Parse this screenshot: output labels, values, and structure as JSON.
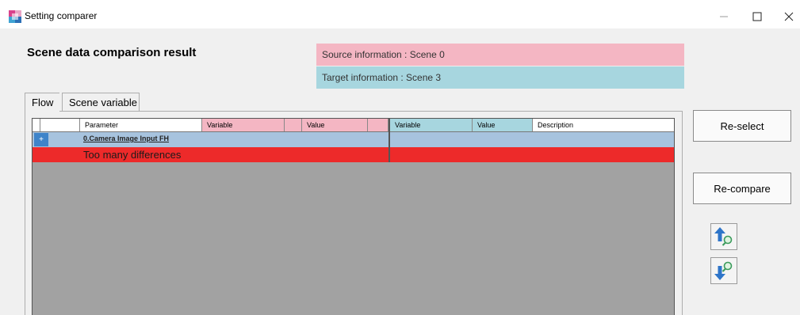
{
  "window": {
    "title": "Setting comparer",
    "icons": {
      "app": "app-icon",
      "minimize": "minimize-icon",
      "maximize": "maximize-icon",
      "close": "close-icon"
    }
  },
  "main": {
    "heading": "Scene data comparison result",
    "source_info": "Source information : Scene 0",
    "target_info": "Target information : Scene 3"
  },
  "tabs": [
    {
      "label": "Flow",
      "selected": true
    },
    {
      "label": "Scene variable",
      "selected": false
    }
  ],
  "grid": {
    "columns": {
      "parameter": "Parameter",
      "source_variable": "Variable",
      "source_value": "Value",
      "target_variable": "Variable",
      "target_value": "Value",
      "description": "Description"
    },
    "rows": [
      {
        "expander": "+",
        "label": "0.Camera Image Input FH"
      },
      {
        "message": "Too many differences"
      }
    ]
  },
  "buttons": {
    "reselect": "Re-select",
    "recompare": "Re-compare",
    "prev_diff_icon": "search-up-icon",
    "next_diff_icon": "search-down-icon"
  },
  "colors": {
    "source": "#f4b6c3",
    "target": "#a7d6df",
    "row_highlight": "#a7c3de",
    "error_row": "#ed2a2a",
    "arrow_blue": "#2e75c9"
  }
}
